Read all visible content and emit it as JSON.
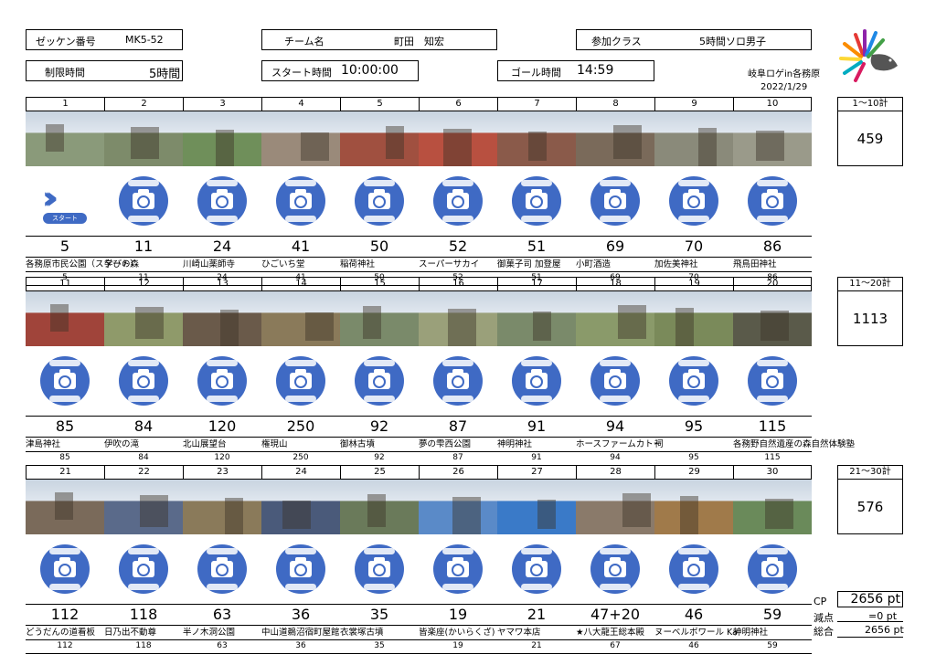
{
  "header": {
    "bib_label": "ゼッケン番号",
    "bib_value": "MK5-52",
    "team_label": "チーム名",
    "team_value": "町田　知宏",
    "class_label": "参加クラス",
    "class_value": "5時間ソロ男子",
    "limit_label": "制限時間",
    "limit_value": "5時間",
    "start_label": "スタート時間",
    "start_value": "10:00:00",
    "goal_label": "ゴール時間",
    "goal_value": "14:59",
    "event_name": "岐阜ロゲin各務原",
    "event_date": "2022/1/29"
  },
  "sections": [
    {
      "cols": [
        "1",
        "2",
        "3",
        "4",
        "5",
        "6",
        "7",
        "8",
        "9",
        "10"
      ],
      "points": [
        "5",
        "11",
        "24",
        "41",
        "50",
        "52",
        "51",
        "69",
        "70",
        "86"
      ],
      "names": [
        "各務原市民公園（スタート）",
        "学びの森",
        "川崎山薬師寺",
        "ひごいち堂",
        "稲荷神社",
        "スーパーサカイ",
        "御菓子司 加登屋",
        "小町酒造",
        "加佐美神社",
        "飛鳥田神社"
      ],
      "small": [
        "5",
        "11",
        "24",
        "41",
        "50",
        "52",
        "51",
        "69",
        "70",
        "86"
      ],
      "sum_label": "1～10計",
      "sum_value": "459"
    },
    {
      "cols": [
        "11",
        "12",
        "13",
        "14",
        "15",
        "16",
        "17",
        "18",
        "19",
        "20"
      ],
      "points": [
        "85",
        "84",
        "120",
        "250",
        "92",
        "87",
        "91",
        "94",
        "95",
        "115"
      ],
      "names": [
        "津島神社",
        "伊吹の滝",
        "北山展望台",
        "権現山",
        "御林古墳",
        "夢の雫西公園",
        "神明神社",
        "ホースファームカトー",
        "祠",
        "各務野自然遺産の森自然体験塾"
      ],
      "small": [
        "85",
        "84",
        "120",
        "250",
        "92",
        "87",
        "91",
        "94",
        "95",
        "115"
      ],
      "sum_label": "11～20計",
      "sum_value": "1113"
    },
    {
      "cols": [
        "21",
        "22",
        "23",
        "24",
        "25",
        "26",
        "27",
        "28",
        "29",
        "30"
      ],
      "points": [
        "112",
        "118",
        "63",
        "36",
        "35",
        "19",
        "21",
        "47+20",
        "46",
        "59"
      ],
      "names": [
        "どうだんの道看板",
        "日乃出不動尊",
        "半ノ木洞公園",
        "中山道鵜沼宿町屋館",
        "衣裳塚古墳",
        "皆楽座(かいらくざ)",
        "ヤマワ本店",
        "★八大龍王総本殿",
        "ヌーベルボワール Ka",
        "神明神社"
      ],
      "small": [
        "112",
        "118",
        "63",
        "36",
        "35",
        "19",
        "21",
        "67",
        "46",
        "59"
      ],
      "sum_label": "21～30計",
      "sum_value": "576"
    }
  ],
  "start_badge": "スタート",
  "totals": {
    "cp_label": "CP",
    "cp_value": "2656 pt",
    "penalty_label": "減点",
    "penalty_value": "=0 pt",
    "total_label": "総合",
    "total_value": "2656 pt"
  },
  "colors": {
    "accent": "#3f6ac4"
  }
}
